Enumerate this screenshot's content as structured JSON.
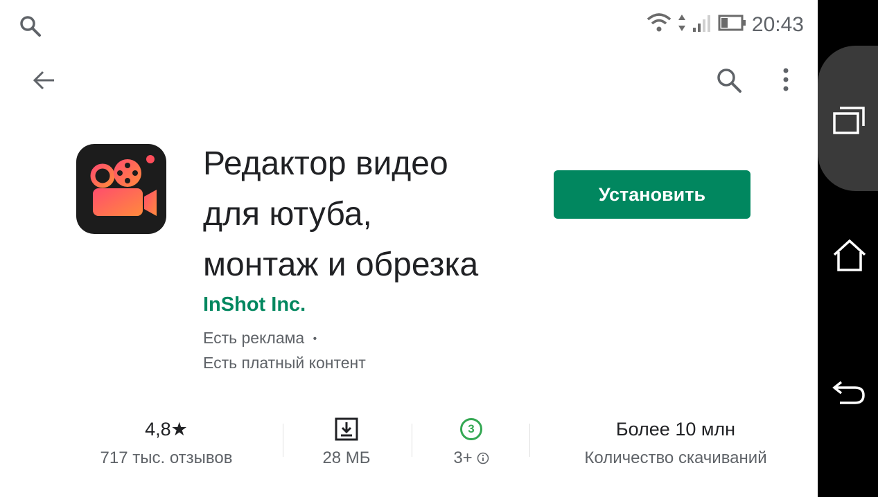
{
  "status_bar": {
    "time": "20:43",
    "search_icon": "search-icon",
    "wifi_icon": "wifi-icon",
    "signal_icon": "signal-icon",
    "battery_icon": "battery-icon"
  },
  "toolbar": {
    "back_icon": "arrow-back-icon",
    "search_icon": "search-icon",
    "more_icon": "more-vert-icon"
  },
  "app": {
    "title_lines": [
      "Редактор видео",
      "для ютуба,",
      "монтаж и обрезка"
    ],
    "developer": "InShot Inc.",
    "ads_notice": "Есть реклама",
    "ads_dot": "•",
    "paid_notice": "Есть платный контент",
    "install_label": "Установить",
    "accent_color": "#01875f"
  },
  "stats": {
    "rating": {
      "value": "4,8",
      "star": "★",
      "label": "717 тыс. отзывов"
    },
    "size": {
      "label": "28 МБ"
    },
    "age": {
      "badge": "3",
      "label": "3+"
    },
    "downloads": {
      "value": "Более 10 млн",
      "label": "Количество скачиваний"
    }
  },
  "nav": {
    "recents_icon": "recents-icon",
    "home_icon": "home-icon",
    "back_icon": "back-icon"
  }
}
